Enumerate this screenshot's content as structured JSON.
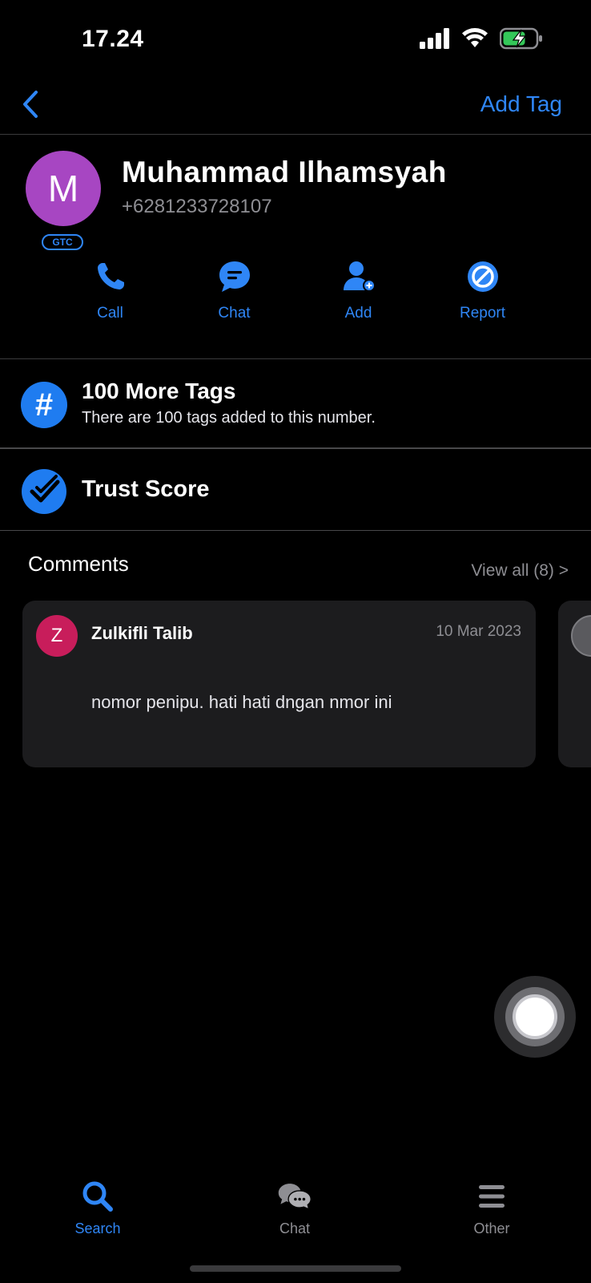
{
  "status_bar": {
    "time": "17.24",
    "icons": [
      "signal-icon",
      "wifi-icon",
      "battery-charging-icon"
    ]
  },
  "nav": {
    "back_icon": "chevron-left-icon",
    "add_tag_label": "Add Tag"
  },
  "contact": {
    "initial": "M",
    "badge": "GTC",
    "name": "Muhammad Ilhamsyah",
    "phone": "+6281233728107"
  },
  "actions": [
    {
      "label": "Call",
      "icon": "phone-icon"
    },
    {
      "label": "Chat",
      "icon": "chat-bubble-icon"
    },
    {
      "label": "Add",
      "icon": "add-user-icon"
    },
    {
      "label": "Report",
      "icon": "block-icon"
    }
  ],
  "tags": {
    "icon_glyph": "#",
    "title": "100 More Tags",
    "subtitle": "There are 100 tags added to this number."
  },
  "trust": {
    "title": "Trust Score",
    "icon": "check-shield-icon"
  },
  "comments": {
    "title": "Comments",
    "view_all": "View all (8) >",
    "items": [
      {
        "initial": "Z",
        "author": "Zulkifli Talib",
        "date": "10 Mar 2023",
        "text": "nomor penipu. hati hati dngan nmor ini"
      }
    ]
  },
  "tab_bar": {
    "tabs": [
      {
        "label": "Search",
        "icon": "search-icon",
        "active": true
      },
      {
        "label": "Chat",
        "icon": "chat-bubbles-icon",
        "active": false
      },
      {
        "label": "Other",
        "icon": "menu-icon",
        "active": false
      }
    ]
  },
  "colors": {
    "accent": "#2f86f6",
    "avatar_contact": "#a746c2",
    "avatar_comment": "#c81d5b",
    "card_bg": "#1c1c1e",
    "battery_charging": "#34c759"
  }
}
